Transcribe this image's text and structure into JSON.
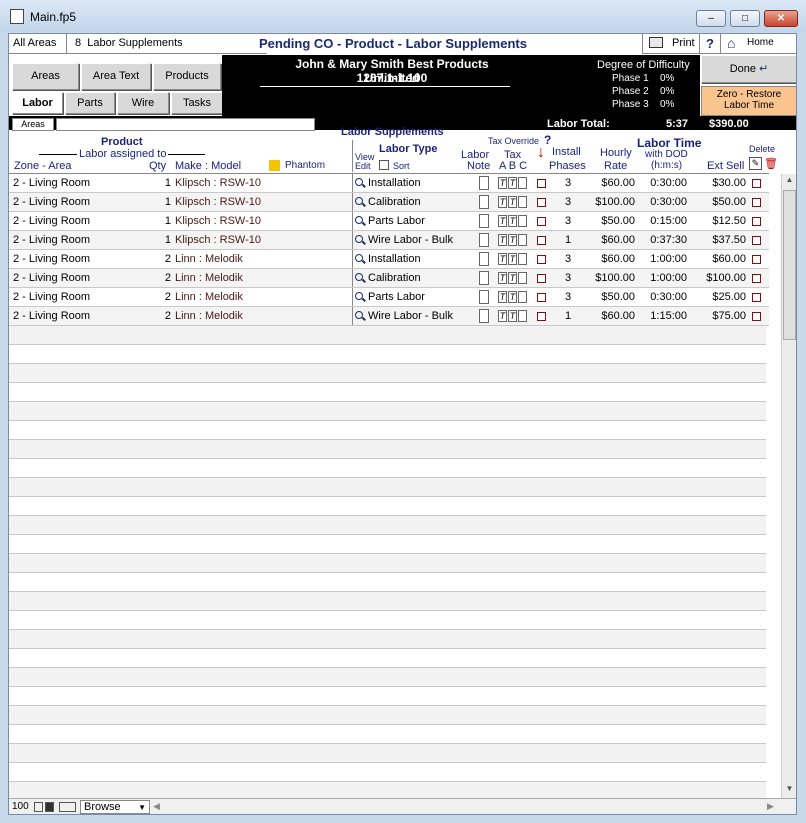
{
  "window": {
    "title": "Main.fp5",
    "minimize": "–",
    "maximize": "□",
    "close": "✕"
  },
  "top": {
    "all_areas": "All Areas",
    "count": "8",
    "count_label": "Labor Supplements",
    "heading": "Pending CO - Product - Labor Supplements",
    "print": "Print",
    "help": "?",
    "home": "Home"
  },
  "tabs_row1": [
    "Areas",
    "Area Text",
    "Products"
  ],
  "tabs_row2": [
    "Labor",
    "Parts",
    "Wire",
    "Tasks"
  ],
  "client": {
    "line1": "John & Mary Smith  Best Products Unlimited",
    "line2": "1267.1-1.100"
  },
  "difficulty": {
    "title": "Degree of Difficulty",
    "phases": [
      {
        "label": "Phase 1",
        "value": "0%"
      },
      {
        "label": "Phase 2",
        "value": "0%"
      },
      {
        "label": "Phase 3",
        "value": "0%"
      }
    ]
  },
  "done": "Done",
  "zero_restore": {
    "line1": "Zero - Restore",
    "line2": "Labor Time"
  },
  "areas_label": "Areas",
  "labor_supplements_label": "Labor Supplements",
  "labor_total": {
    "label": "Labor Total:",
    "time": "5:37",
    "amount": "$390.00"
  },
  "columns": {
    "product": "Product",
    "labor_assigned": "Labor assigned to",
    "zone_area": "Zone - Area",
    "qty": "Qty",
    "make_model": "Make : Model",
    "phantom": "Phantom",
    "view": "View",
    "edit": "Edit",
    "labor_type": "Labor Type",
    "sort": "Sort",
    "labor": "Labor",
    "note": "Note",
    "tax_override": "Tax Override",
    "tax_q": "?",
    "tax": "Tax",
    "tax_abc": "A B C",
    "install": "Install",
    "phases": "Phases",
    "hourly": "Hourly",
    "rate": "Rate",
    "labor_time": "Labor Time",
    "with_dod": "with DOD",
    "hms": "(h:m:s)",
    "ext_sell": "Ext Sell",
    "delete": "Delete"
  },
  "rows": [
    {
      "zone": "2 - Living Room",
      "qty": "1",
      "model": "Klipsch : RSW-10",
      "type": "Installation",
      "ta": "T",
      "tb": "T",
      "phases": "3",
      "rate": "$60.00",
      "time": "0:30:00",
      "ext": "$30.00"
    },
    {
      "zone": "2 - Living Room",
      "qty": "1",
      "model": "Klipsch : RSW-10",
      "type": "Calibration",
      "ta": "T",
      "tb": "T",
      "phases": "3",
      "rate": "$100.00",
      "time": "0:30:00",
      "ext": "$50.00"
    },
    {
      "zone": "2 - Living Room",
      "qty": "1",
      "model": "Klipsch : RSW-10",
      "type": "Parts Labor",
      "ta": "T",
      "tb": "T",
      "phases": "3",
      "rate": "$50.00",
      "time": "0:15:00",
      "ext": "$12.50"
    },
    {
      "zone": "2 - Living Room",
      "qty": "1",
      "model": "Klipsch : RSW-10",
      "type": "Wire Labor - Bulk",
      "ta": "T",
      "tb": "T",
      "phases": "1",
      "rate": "$60.00",
      "time": "0:37:30",
      "ext": "$37.50"
    },
    {
      "zone": "2 - Living Room",
      "qty": "2",
      "model": "Linn : Melodik",
      "type": "Installation",
      "ta": "T",
      "tb": "T",
      "phases": "3",
      "rate": "$60.00",
      "time": "1:00:00",
      "ext": "$60.00"
    },
    {
      "zone": "2 - Living Room",
      "qty": "2",
      "model": "Linn : Melodik",
      "type": "Calibration",
      "ta": "T",
      "tb": "T",
      "phases": "3",
      "rate": "$100.00",
      "time": "1:00:00",
      "ext": "$100.00"
    },
    {
      "zone": "2 - Living Room",
      "qty": "2",
      "model": "Linn : Melodik",
      "type": "Parts Labor",
      "ta": "T",
      "tb": "T",
      "phases": "3",
      "rate": "$50.00",
      "time": "0:30:00",
      "ext": "$25.00"
    },
    {
      "zone": "2 - Living Room",
      "qty": "2",
      "model": "Linn : Melodik",
      "type": "Wire Labor - Bulk",
      "ta": "T",
      "tb": "T",
      "phases": "1",
      "rate": "$60.00",
      "time": "1:15:00",
      "ext": "$75.00"
    }
  ],
  "status": {
    "zoom": "100",
    "mode": "Browse"
  },
  "colors": {
    "phantom": "#f5c400",
    "delete_red": "#c00000",
    "orange": "#f9c48e"
  }
}
